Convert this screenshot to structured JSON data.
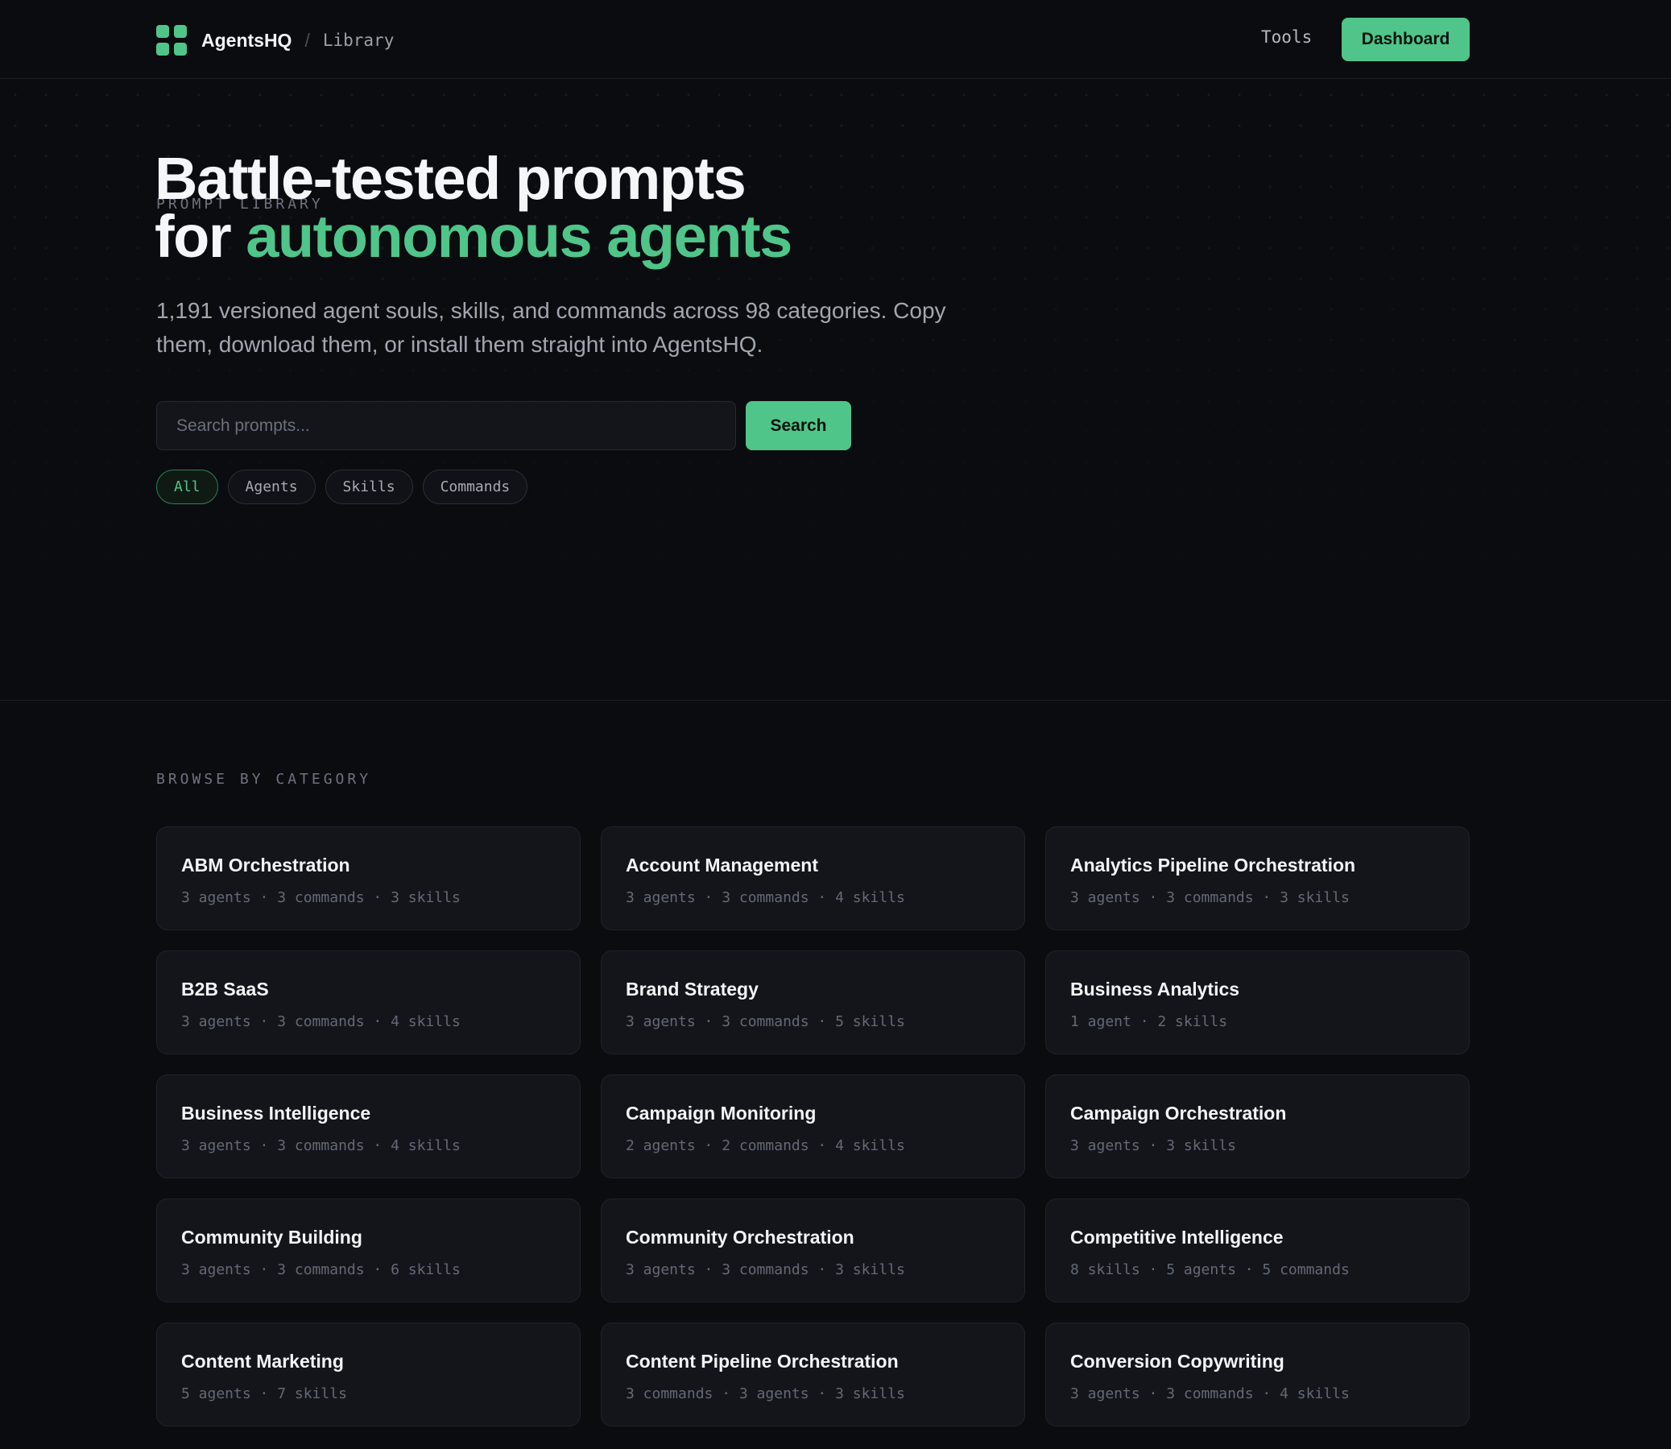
{
  "nav": {
    "brand": "AgentsHQ",
    "separator": "/",
    "crumb": "Library",
    "tools_label": "Tools",
    "dashboard_label": "Dashboard"
  },
  "hero": {
    "eyebrow": "PROMPT LIBRARY",
    "title_line1": "Battle-tested prompts",
    "title_line2_prefix": "for ",
    "title_line2_accent": "autonomous agents",
    "description": "1,191 versioned agent souls, skills, and commands across 98 categories. Copy them, download them, or install them straight into AgentsHQ.",
    "search_placeholder": "Search prompts...",
    "search_button": "Search",
    "filters": [
      {
        "label": "All",
        "active": true
      },
      {
        "label": "Agents",
        "active": false
      },
      {
        "label": "Skills",
        "active": false
      },
      {
        "label": "Commands",
        "active": false
      }
    ]
  },
  "categories": {
    "label": "BROWSE BY CATEGORY",
    "items": [
      {
        "title": "ABM Orchestration",
        "meta": "3 agents · 3 commands · 3 skills"
      },
      {
        "title": "Account Management",
        "meta": "3 agents · 3 commands · 4 skills"
      },
      {
        "title": "Analytics Pipeline Orchestration",
        "meta": "3 agents · 3 commands · 3 skills"
      },
      {
        "title": "B2B SaaS",
        "meta": "3 agents · 3 commands · 4 skills"
      },
      {
        "title": "Brand Strategy",
        "meta": "3 agents · 3 commands · 5 skills"
      },
      {
        "title": "Business Analytics",
        "meta": "1 agent · 2 skills"
      },
      {
        "title": "Business Intelligence",
        "meta": "3 agents · 3 commands · 4 skills"
      },
      {
        "title": "Campaign Monitoring",
        "meta": "2 agents · 2 commands · 4 skills"
      },
      {
        "title": "Campaign Orchestration",
        "meta": "3 agents · 3 skills"
      },
      {
        "title": "Community Building",
        "meta": "3 agents · 3 commands · 6 skills"
      },
      {
        "title": "Community Orchestration",
        "meta": "3 agents · 3 commands · 3 skills"
      },
      {
        "title": "Competitive Intelligence",
        "meta": "8 skills · 5 agents · 5 commands"
      },
      {
        "title": "Content Marketing",
        "meta": "5 agents · 7 skills"
      },
      {
        "title": "Content Pipeline Orchestration",
        "meta": "3 commands · 3 agents · 3 skills"
      },
      {
        "title": "Conversion Copywriting",
        "meta": "3 agents · 3 commands · 4 skills"
      }
    ]
  },
  "colors": {
    "accent": "#4fc58a",
    "background": "#0b0c0f",
    "card": "#13151b"
  }
}
